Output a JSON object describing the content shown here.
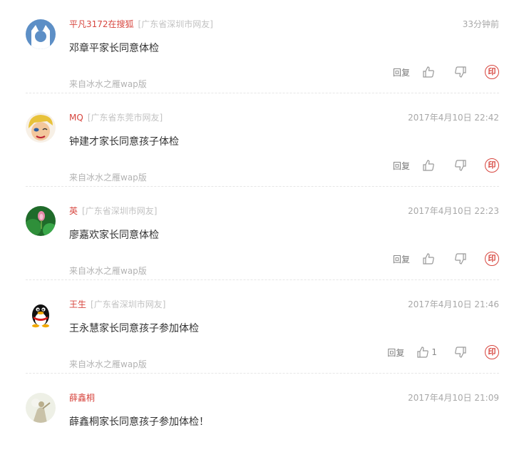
{
  "colors": {
    "username": "#d7463f",
    "location": "#c2c2c2",
    "stamp": "#d7463f"
  },
  "labels": {
    "reply": "回复"
  },
  "comments": [
    {
      "user": "平凡3172在搜狐",
      "location": "[广东省深圳市网友]",
      "time": "33分钟前",
      "text": "邓章平家长同意体检",
      "source": "来自冰水之雁wap版",
      "likes": "",
      "stamp": "印",
      "avatar": "default-avatar"
    },
    {
      "user": "MQ",
      "location": "[广东省东莞市网友]",
      "time": "2017年4月10日 22:42",
      "text": "钟建才家长同意孩子体检",
      "source": "来自冰水之雁wap版",
      "likes": "",
      "stamp": "印",
      "avatar": "cartoon-avatar"
    },
    {
      "user": "英",
      "location": "[广东省深圳市网友]",
      "time": "2017年4月10日 22:23",
      "text": "廖嘉欢家长同意体检",
      "source": "来自冰水之雁wap版",
      "likes": "",
      "stamp": "印",
      "avatar": "lotus-avatar"
    },
    {
      "user": "王生",
      "location": "[广东省深圳市网友]",
      "time": "2017年4月10日 21:46",
      "text": "王永慧家长同意孩子参加体检",
      "source": "来自冰水之雁wap版",
      "likes": "1",
      "stamp": "印",
      "avatar": "penguin-avatar"
    },
    {
      "user": "薛鑫桐",
      "location": "",
      "time": "2017年4月10日 21:09",
      "text": "薛鑫桐家长同意孩子参加体检！",
      "source": "",
      "likes": "",
      "stamp": "",
      "avatar": "photo-avatar"
    }
  ]
}
